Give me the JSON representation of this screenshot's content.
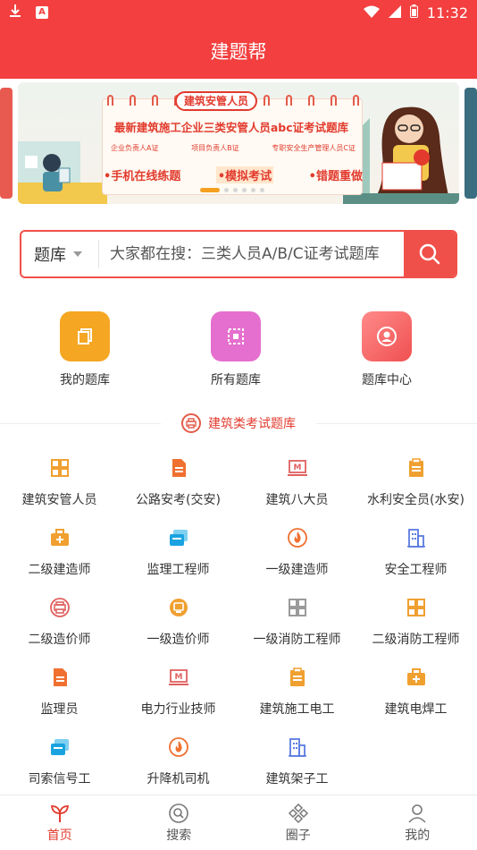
{
  "status_bar": {
    "time": "11:32",
    "notification_badge": "A"
  },
  "header": {
    "title": "建题帮"
  },
  "banner": {
    "tag": "建筑安管人员",
    "title": "最新建筑施工企业三类安管人员abc证考试题库",
    "subtitles": [
      "企业负责人A证",
      "项目负责人B证",
      "专职安全生产管理人员C证"
    ],
    "features": [
      "手机在线练题",
      "模拟考试",
      "错题重做"
    ],
    "dot_count": 6,
    "active_dot": 0
  },
  "search": {
    "scope_label": "题库",
    "placeholder": "大家都在搜：三类人员A/B/C证考试题库"
  },
  "quick_entries": [
    {
      "label": "我的题库",
      "icon": "copy-icon",
      "color": "#f5a623"
    },
    {
      "label": "所有题库",
      "icon": "grid-square-icon",
      "color": "#e56fce"
    },
    {
      "label": "题库中心",
      "icon": "user-circle-icon",
      "color": "#f26d6d"
    }
  ],
  "section": {
    "title": "建筑类考试题库"
  },
  "categories": [
    {
      "label": "建筑安管人员",
      "icon": "grid-icon",
      "color": "#f0a030"
    },
    {
      "label": "公路安考(交安)",
      "icon": "document-icon",
      "color": "#f07030"
    },
    {
      "label": "建筑八大员",
      "icon": "m-board-icon",
      "color": "#e06060"
    },
    {
      "label": "水利安全员(水安)",
      "icon": "clipboard-icon",
      "color": "#f0a030"
    },
    {
      "label": "二级建造师",
      "icon": "medkit-icon",
      "color": "#f0a030"
    },
    {
      "label": "监理工程师",
      "icon": "cards-icon",
      "color": "#1aa3e0"
    },
    {
      "label": "一级建造师",
      "icon": "flame-icon",
      "color": "#f07030"
    },
    {
      "label": "安全工程师",
      "icon": "building-icon",
      "color": "#5a7be0"
    },
    {
      "label": "二级造价师",
      "icon": "printer-icon",
      "color": "#e06060"
    },
    {
      "label": "一级造价师",
      "icon": "coin-icon",
      "color": "#f0a030"
    },
    {
      "label": "一级消防工程师",
      "icon": "grid-icon",
      "color": "#9a9a9a"
    },
    {
      "label": "二级消防工程师",
      "icon": "grid-icon",
      "color": "#f0a030"
    },
    {
      "label": "监理员",
      "icon": "document-icon",
      "color": "#f07030"
    },
    {
      "label": "电力行业技师",
      "icon": "m-board-icon",
      "color": "#e06060"
    },
    {
      "label": "建筑施工电工",
      "icon": "clipboard-icon",
      "color": "#f0a030"
    },
    {
      "label": "建筑电焊工",
      "icon": "medkit-icon",
      "color": "#f0a030"
    },
    {
      "label": "司索信号工",
      "icon": "cards-icon",
      "color": "#1aa3e0"
    },
    {
      "label": "升降机司机",
      "icon": "flame-icon",
      "color": "#f07030"
    },
    {
      "label": "建筑架子工",
      "icon": "building-icon",
      "color": "#5a7be0"
    }
  ],
  "bottom_nav": [
    {
      "label": "首页",
      "icon": "sprout-icon",
      "active": true
    },
    {
      "label": "搜索",
      "icon": "search-icon",
      "active": false
    },
    {
      "label": "圈子",
      "icon": "diamond-cluster-icon",
      "active": false
    },
    {
      "label": "我的",
      "icon": "person-icon",
      "active": false
    }
  ],
  "colors": {
    "brand": "#f33f3f",
    "accent": "#e23b2e"
  }
}
